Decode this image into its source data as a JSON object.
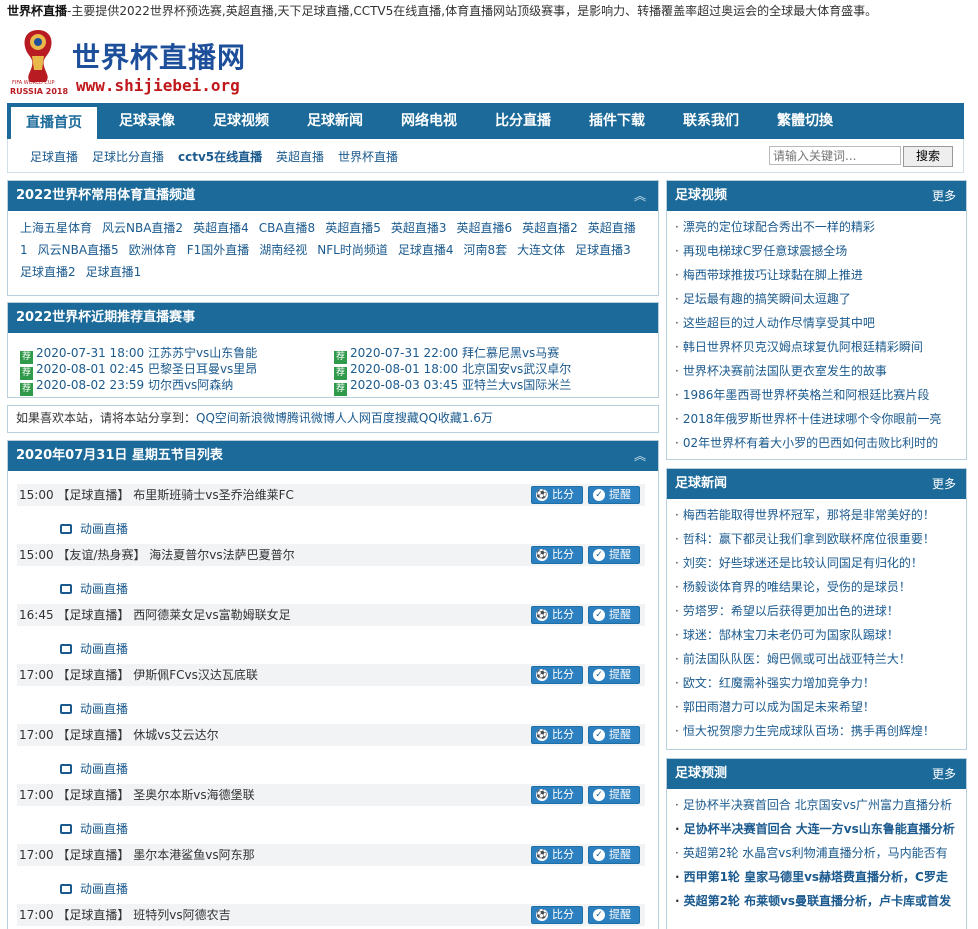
{
  "topbar": {
    "site": "世界杯直播",
    "desc": "-主要提供2022世界杯预选赛,英超直播,天下足球直播,CCTV5在线直播,体育直播网站顶级赛事，是影响力、转播覆盖率超过奥运会的全球最大体育盛事。"
  },
  "logo": {
    "title": "世界杯直播网",
    "url": "www.shijiebei.org",
    "emblem_text": "RUSSIA 2018",
    "emblem_small": "FIFA WORLD CUP"
  },
  "nav": [
    "直播首页",
    "足球录像",
    "足球视频",
    "足球新闻",
    "网络电视",
    "比分直播",
    "插件下载",
    "联系我们",
    "繁體切換"
  ],
  "subnav": [
    "足球直播",
    "足球比分直播",
    "cctv5在线直播",
    "英超直播",
    "世界杯直播"
  ],
  "search": {
    "placeholder": "请输入关键词...",
    "button": "搜索"
  },
  "channels": {
    "title": "2022世界杯常用体育直播频道",
    "up": "︽",
    "items": [
      "上海五星体育",
      "风云NBA直播2",
      "英超直播4",
      "CBA直播8",
      "英超直播5",
      "英超直播3",
      "英超直播6",
      "英超直播2",
      "英超直播1",
      "风云NBA直播5",
      "欧洲体育",
      "F1国外直播",
      "湖南经视",
      "NFL时尚频道",
      "足球直播4",
      "河南8套",
      "大连文体",
      "足球直播3",
      "足球直播2",
      "足球直播1"
    ]
  },
  "recommend": {
    "title": "2022世界杯近期推荐直播赛事",
    "tag": "荐",
    "items": [
      "2020-07-31 18:00 江苏苏宁vs山东鲁能",
      "2020-07-31 22:00 拜仁慕尼黑vs马赛",
      "2020-08-01 02:45 巴黎圣日耳曼vs里昂",
      "2020-08-01 18:00 北京国安vs武汉卓尔",
      "2020-08-02 23:59 切尔西vs阿森纳",
      "2020-08-03 03:45 亚特兰大vs国际米兰"
    ]
  },
  "share": {
    "pre": "如果喜欢本站，请将本站",
    "label": "分享到：",
    "links": "QQ空间新浪微博腾讯微博人人网百度搜藏QQ收藏1.6万"
  },
  "schedule": {
    "title": "2020年07月31日 星期五节目列表",
    "up": "︽",
    "btn_score": "比分",
    "btn_remind": "提醒",
    "anim_label": "动画直播",
    "rows": [
      "15:00 【足球直播】 布里斯班骑士vs圣乔治维莱FC",
      "15:00 【友谊/热身赛】 海法夏普尔vs法萨巴夏普尔",
      "16:45 【足球直播】 西阿德莱女足vs富勒姆联女足",
      "17:00 【足球直播】 伊斯佩FCvs汉达瓦底联",
      "17:00 【足球直播】 休城vs艾云达尔",
      "17:00 【足球直播】 圣奥尔本斯vs海德堡联",
      "17:00 【足球直播】 墨尔本港鲨鱼vs阿东那",
      "17:00 【足球直播】 班特列vs阿德农吉"
    ]
  },
  "videos": {
    "title": "足球视频",
    "more": "更多",
    "items": [
      "漂亮的定位球配合秀出不一样的精彩",
      "再现电梯球C罗任意球震撼全场",
      "梅西带球推拔巧让球黏在脚上推进",
      "足坛最有趣的搞笑瞬间太逗趣了",
      "这些超巨的过人动作尽情享受其中吧",
      "韩日世界杯贝克汉姆点球复仇阿根廷精彩瞬间",
      "世界杯决赛前法国队更衣室发生的故事",
      "1986年墨西哥世界杯英格兰和阿根廷比赛片段",
      "2018年俄罗斯世界杯十佳进球哪个令你眼前一亮",
      "02年世界杯有着大小罗的巴西如何击败比利时的"
    ]
  },
  "news": {
    "title": "足球新闻",
    "more": "更多",
    "items": [
      "梅西若能取得世界杯冠军，那将是非常美好的！",
      "哲科：赢下都灵让我们拿到欧联杯席位很重要！",
      "刘奕：好些球迷还是比较认同国足有归化的！",
      "杨毅谈体育界的唯结果论，受伤的是球员！",
      "劳塔罗：希望以后获得更加出色的进球！",
      "球迷：郜林宝刀未老仍可为国家队踢球！",
      "前法国队队医：姆巴佩或可出战亚特兰大！",
      "欧文：红魔需补强实力增加竞争力！",
      "郭田雨潜力可以成为国足未来希望！",
      "恒大祝贺廖力生完成球队百场：携手再创辉煌！"
    ]
  },
  "predict": {
    "title": "足球预测",
    "more": "更多",
    "items": [
      "足协杯半决赛首回合 北京国安vs广州富力直播分析",
      "足协杯半决赛首回合 大连一方vs山东鲁能直播分析",
      "英超第2轮 水晶宫vs利物浦直播分析，马内能否有",
      "西甲第1轮 皇家马德里vs赫塔费直播分析，C罗走",
      "英超第2轮 布莱顿vs曼联直播分析，卢卡库或首发"
    ]
  }
}
